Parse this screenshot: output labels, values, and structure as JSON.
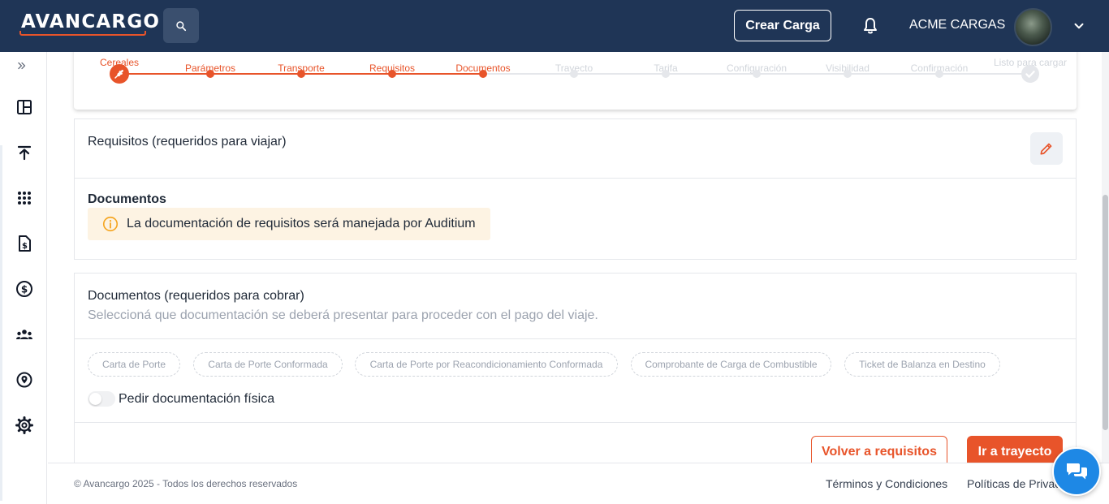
{
  "header": {
    "logo_text": "AVANCARGO",
    "create_label": "Crear Carga",
    "company_name": "ACME CARGAS"
  },
  "stepper": {
    "steps": [
      {
        "label": "Cereales",
        "state": "current"
      },
      {
        "label": "Parámetros",
        "state": "done"
      },
      {
        "label": "Transporte",
        "state": "done"
      },
      {
        "label": "Requisitos",
        "state": "done"
      },
      {
        "label": "Documentos",
        "state": "done"
      },
      {
        "label": "Trayecto",
        "state": "pending"
      },
      {
        "label": "Tarifa",
        "state": "pending"
      },
      {
        "label": "Configuración",
        "state": "pending"
      },
      {
        "label": "Visibilidad",
        "state": "pending"
      },
      {
        "label": "Confirmación",
        "state": "pending"
      },
      {
        "label": "Listo para cargar",
        "state": "final"
      }
    ]
  },
  "requirements_card": {
    "title": "Requisitos (requeridos para viajar)",
    "documents_heading": "Documentos",
    "info_message": "La documentación de requisitos será manejada por Auditium"
  },
  "payment_docs_card": {
    "title": "Documentos (requeridos para cobrar)",
    "subtitle": "Seleccioná que documentación se deberá presentar para proceder con el pago del viaje.",
    "chips": [
      "Carta de Porte",
      "Carta de Porte Conformada",
      "Carta de Porte por Reacondicionamiento Conformada",
      "Comprobante de Carga de Combustible",
      "Ticket de Balanza en Destino"
    ],
    "toggle_label": "Pedir documentación física",
    "toggle_on": false
  },
  "actions": {
    "back_label": "Volver a requisitos",
    "next_label": "Ir a trayecto"
  },
  "footer": {
    "copyright": "© Avancargo 2025 - Todos los derechos reservados",
    "terms": "Términos y Condiciones",
    "privacy": "Políticas de Privacidad"
  },
  "colors": {
    "brand_orange": "#e8542a",
    "navy": "#1f3556",
    "chat_blue": "#1e88e5",
    "info_bg": "#fdf3e3"
  },
  "icons": {
    "search": "search-icon",
    "bell": "bell-icon",
    "edit": "pencil-icon",
    "info": "info-icon",
    "chat": "chat-icon"
  }
}
